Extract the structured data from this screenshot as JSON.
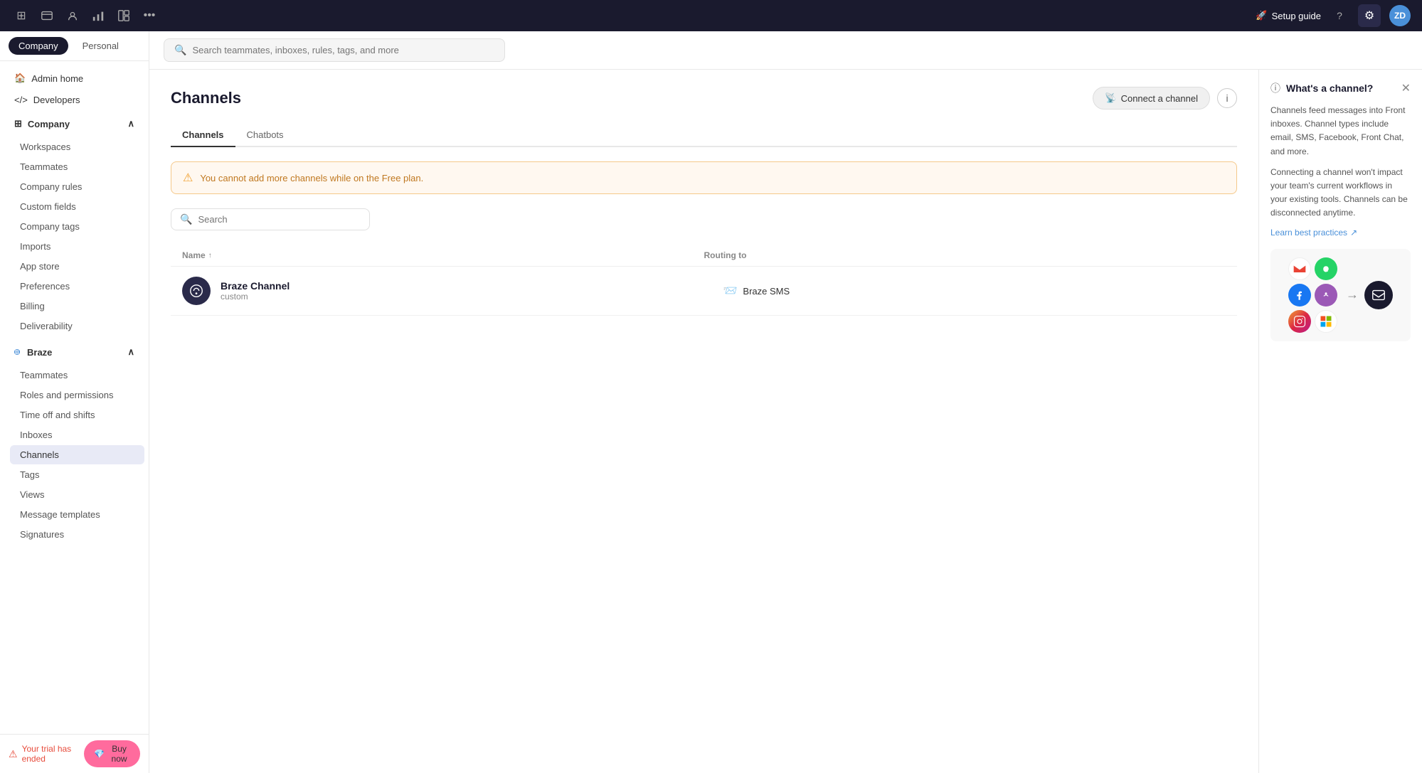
{
  "topbar": {
    "icons": [
      "grid-icon",
      "calendar-icon",
      "contacts-icon",
      "chart-icon",
      "layout-icon",
      "more-icon"
    ],
    "setup_guide": "Setup guide",
    "avatar_initials": "ZD",
    "avatar_bg": "#4a90d9"
  },
  "sidebar": {
    "tabs": [
      {
        "label": "Company",
        "active": true
      },
      {
        "label": "Personal",
        "active": false
      }
    ],
    "top_items": [
      {
        "label": "Admin home",
        "icon": "home-icon"
      },
      {
        "label": "Developers",
        "icon": "code-icon"
      }
    ],
    "company_section": {
      "label": "Company",
      "items": [
        {
          "label": "Workspaces"
        },
        {
          "label": "Teammates"
        },
        {
          "label": "Company rules"
        },
        {
          "label": "Custom fields"
        },
        {
          "label": "Company tags"
        },
        {
          "label": "Imports"
        },
        {
          "label": "App store"
        },
        {
          "label": "Preferences"
        },
        {
          "label": "Billing"
        },
        {
          "label": "Deliverability"
        }
      ]
    },
    "braze_section": {
      "label": "Braze",
      "indicator": "B",
      "items": [
        {
          "label": "Teammates"
        },
        {
          "label": "Roles and permissions"
        },
        {
          "label": "Time off and shifts"
        },
        {
          "label": "Inboxes"
        },
        {
          "label": "Channels",
          "active": true
        },
        {
          "label": "Tags"
        },
        {
          "label": "Views"
        },
        {
          "label": "Message templates"
        },
        {
          "label": "Signatures"
        }
      ]
    }
  },
  "search": {
    "placeholder": "Search teammates, inboxes, rules, tags, and more"
  },
  "page": {
    "title": "Channels",
    "connect_btn": "Connect a channel",
    "tabs": [
      {
        "label": "Channels",
        "active": true
      },
      {
        "label": "Chatbots",
        "active": false
      }
    ],
    "warning": "You cannot add more channels while on the Free plan.",
    "channel_search_placeholder": "Search",
    "table": {
      "col_name": "Name",
      "col_routing": "Routing to",
      "rows": [
        {
          "name": "Braze Channel",
          "type": "custom",
          "routing_icon": "📨",
          "routing_name": "Braze SMS"
        }
      ]
    }
  },
  "info_panel": {
    "title": "What's a channel?",
    "text1": "Channels feed messages into Front inboxes. Channel types include email, SMS, Facebook, Front Chat, and more.",
    "text2": "Connecting a channel won't impact your team's current workflows in your existing tools. Channels can be disconnected anytime.",
    "learn_link": "Learn best practices"
  },
  "bottom_bar": {
    "trial_text": "Your trial has ended",
    "buy_btn": "Buy now"
  }
}
